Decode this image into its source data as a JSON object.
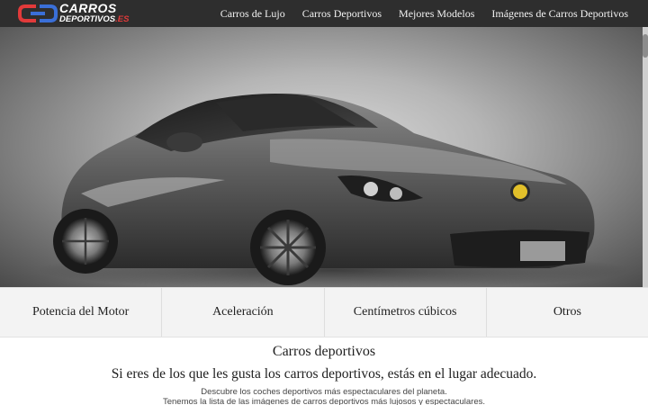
{
  "header": {
    "logo_main": "CARROS",
    "logo_sub": "DEPORTIVOS",
    "logo_domain": ".ES",
    "nav": [
      {
        "label": "Carros de Lujo"
      },
      {
        "label": "Carros Deportivos"
      },
      {
        "label": "Mejores Modelos"
      },
      {
        "label": "Imágenes de Carros Deportivos"
      }
    ]
  },
  "tabs": [
    {
      "label": "Potencia del Motor"
    },
    {
      "label": "Aceleración"
    },
    {
      "label": "Centímetros cúbicos"
    },
    {
      "label": "Otros"
    }
  ],
  "intro": {
    "title": "Carros deportivos",
    "subtitle": "Si eres de los que les gusta los carros deportivos, estás en el lugar adecuado.",
    "line1": "Descubre los coches deportivos más espectaculares del planeta.",
    "line2": "Tenemos la lista de las imágenes de carros deportivos más lujosos y espectaculares."
  },
  "colors": {
    "header_bg": "#2e2e2e",
    "logo_red": "#e23a3a",
    "logo_blue": "#3a6fd8"
  }
}
